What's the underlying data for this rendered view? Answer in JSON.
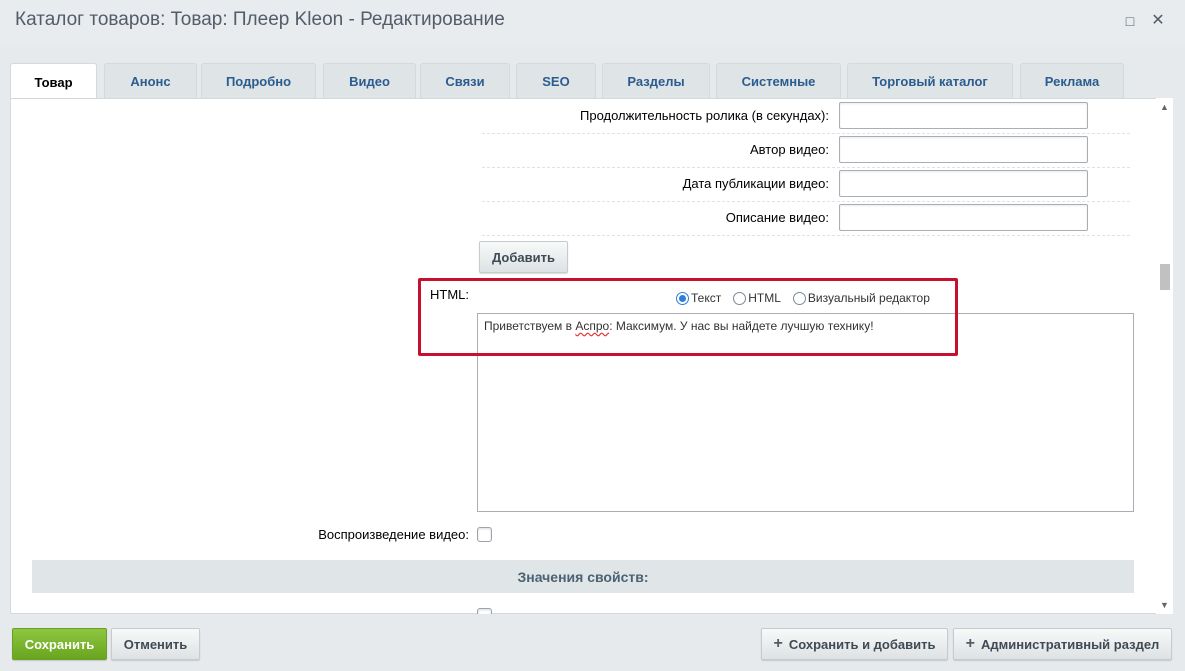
{
  "window": {
    "title": "Каталог товаров: Товар: Плеер Kleon - Редактирование",
    "maximize_icon": "□",
    "close_icon": "✕"
  },
  "tabs": [
    {
      "label": "Товар",
      "active": true
    },
    {
      "label": "Анонс"
    },
    {
      "label": "Подробно"
    },
    {
      "label": "Видео"
    },
    {
      "label": "Связи"
    },
    {
      "label": "SEO"
    },
    {
      "label": "Разделы"
    },
    {
      "label": "Системные"
    },
    {
      "label": "Торговый каталог"
    },
    {
      "label": "Реклама"
    }
  ],
  "video_fields": {
    "duration_label": "Продолжительность ролика (в секундах):",
    "author_label": "Автор видео:",
    "date_label": "Дата публикации видео:",
    "description_label": "Описание видео:",
    "add_button": "Добавить"
  },
  "html_field": {
    "label": "HTML:",
    "radio_text": "Текст",
    "radio_html": "HTML",
    "radio_visual": "Визуальный редактор",
    "selected": "Текст",
    "content_before": "Приветствуем в ",
    "content_misspelled": "Аспро",
    "content_after": ": Максимум. У нас вы найдете лучшую технику!"
  },
  "video_playback": {
    "label": "Воспроизведение видео:",
    "checked": false
  },
  "section": {
    "title": "Значения свойств:"
  },
  "footer": {
    "save": "Сохранить",
    "cancel": "Отменить",
    "save_and_add": "Сохранить и добавить",
    "admin_section": "Административный раздел"
  },
  "scrollbar": {
    "up_icon": "▲",
    "down_icon": "▼"
  },
  "colors": {
    "accent_green": "#7ab72f",
    "tab_link": "#2b5c8f",
    "highlight_red": "#c8102e"
  }
}
